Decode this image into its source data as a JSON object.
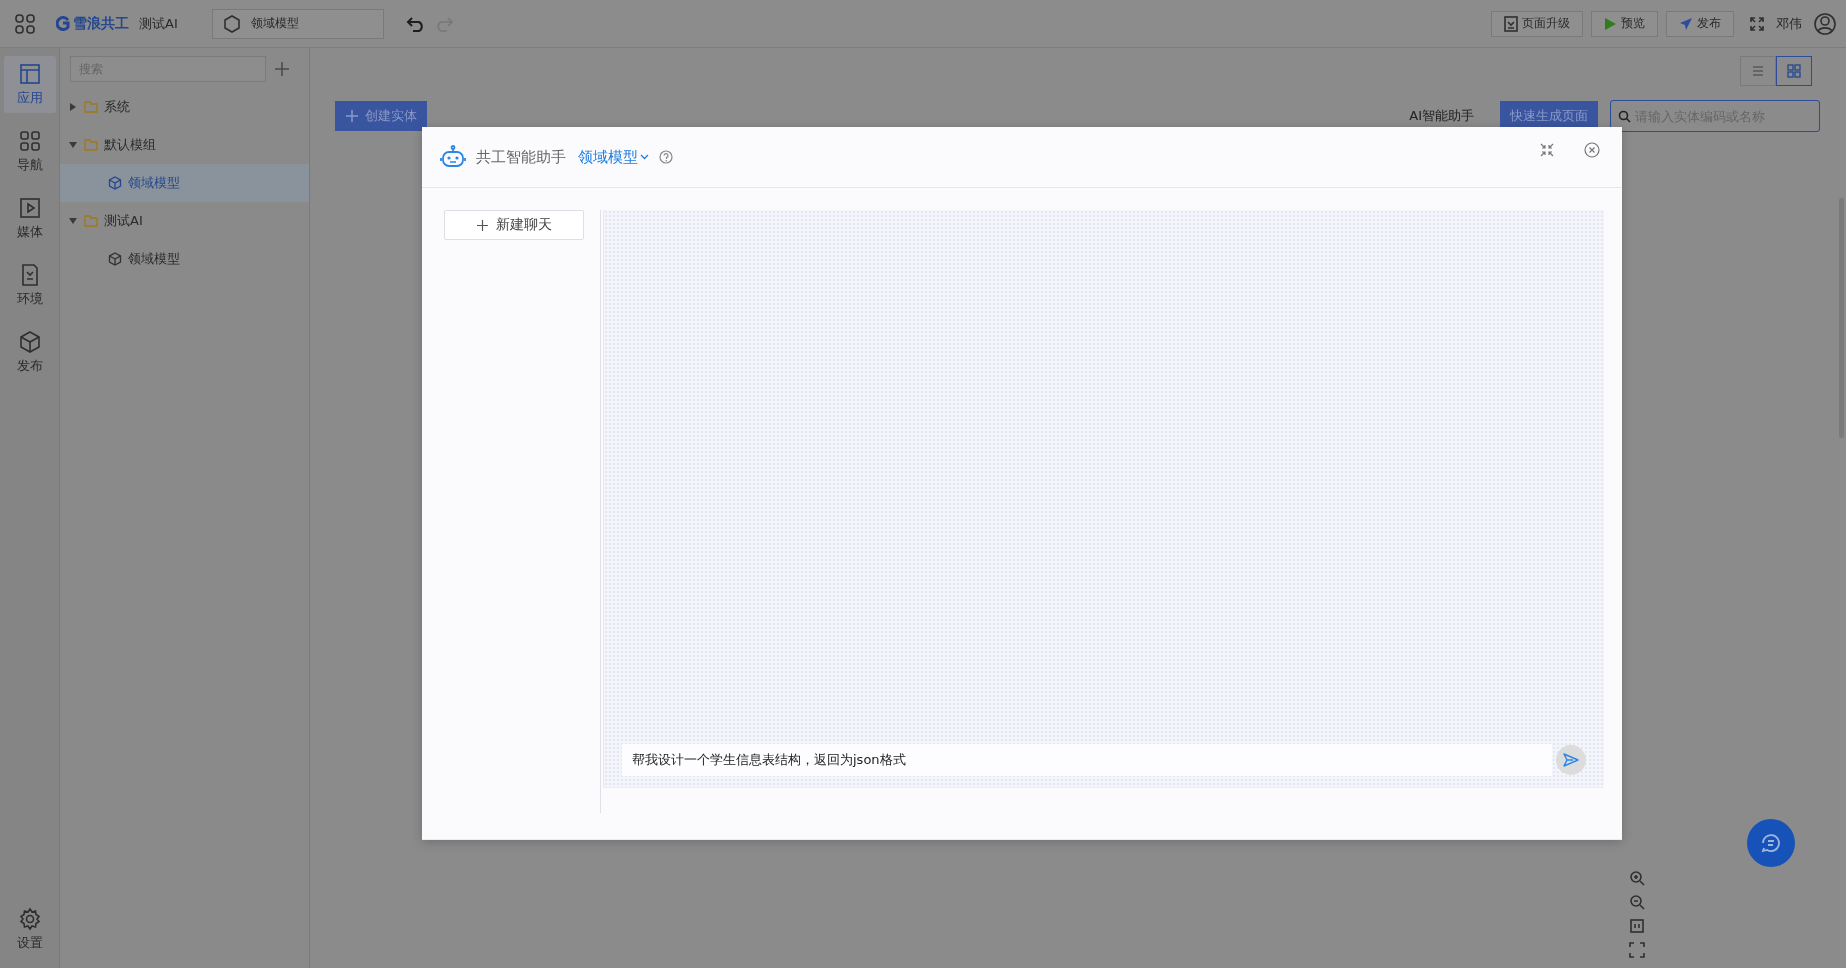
{
  "header": {
    "logo_text": "雪浪共工",
    "project": "测试AI",
    "model_tab": "领域模型",
    "buttons": [
      {
        "label": "页面升级",
        "kind": "upgrade"
      },
      {
        "label": "预览",
        "kind": "preview"
      },
      {
        "label": "发布",
        "kind": "publish"
      }
    ],
    "user": "邓伟"
  },
  "rail": {
    "items": [
      {
        "label": "应用",
        "kind": "layout",
        "selected": true
      },
      {
        "label": "导航",
        "kind": "grid",
        "selected": false
      },
      {
        "label": "媒体",
        "kind": "media",
        "selected": false
      },
      {
        "label": "环境",
        "kind": "env",
        "selected": false
      },
      {
        "label": "发布",
        "kind": "cube",
        "selected": false
      }
    ],
    "settings": "设置"
  },
  "tree": {
    "search_placeholder": "搜索",
    "items": [
      {
        "label": "系统",
        "expanded": false,
        "selected": false
      },
      {
        "label": "默认模组",
        "expanded": true,
        "selected": false,
        "children": [
          {
            "label": "领域模型",
            "selected": true
          }
        ]
      },
      {
        "label": "测试AI",
        "expanded": true,
        "selected": false,
        "children": [
          {
            "label": "领域模型",
            "selected": false
          }
        ]
      }
    ]
  },
  "canvas": {
    "create_button": "创建实体",
    "ai_label": "AI智能助手",
    "generate_button": "快速生成页面",
    "search_placeholder": "请输入实体编码或名称",
    "view_modes": [
      {
        "kind": "list",
        "selected": false
      },
      {
        "kind": "grid",
        "selected": true
      }
    ]
  },
  "dialog": {
    "title": "共工智能助手",
    "model": "领域模型",
    "new_chat": "新建聊天",
    "input_value": "帮我设计一个学生信息表结构，返回为json格式"
  }
}
